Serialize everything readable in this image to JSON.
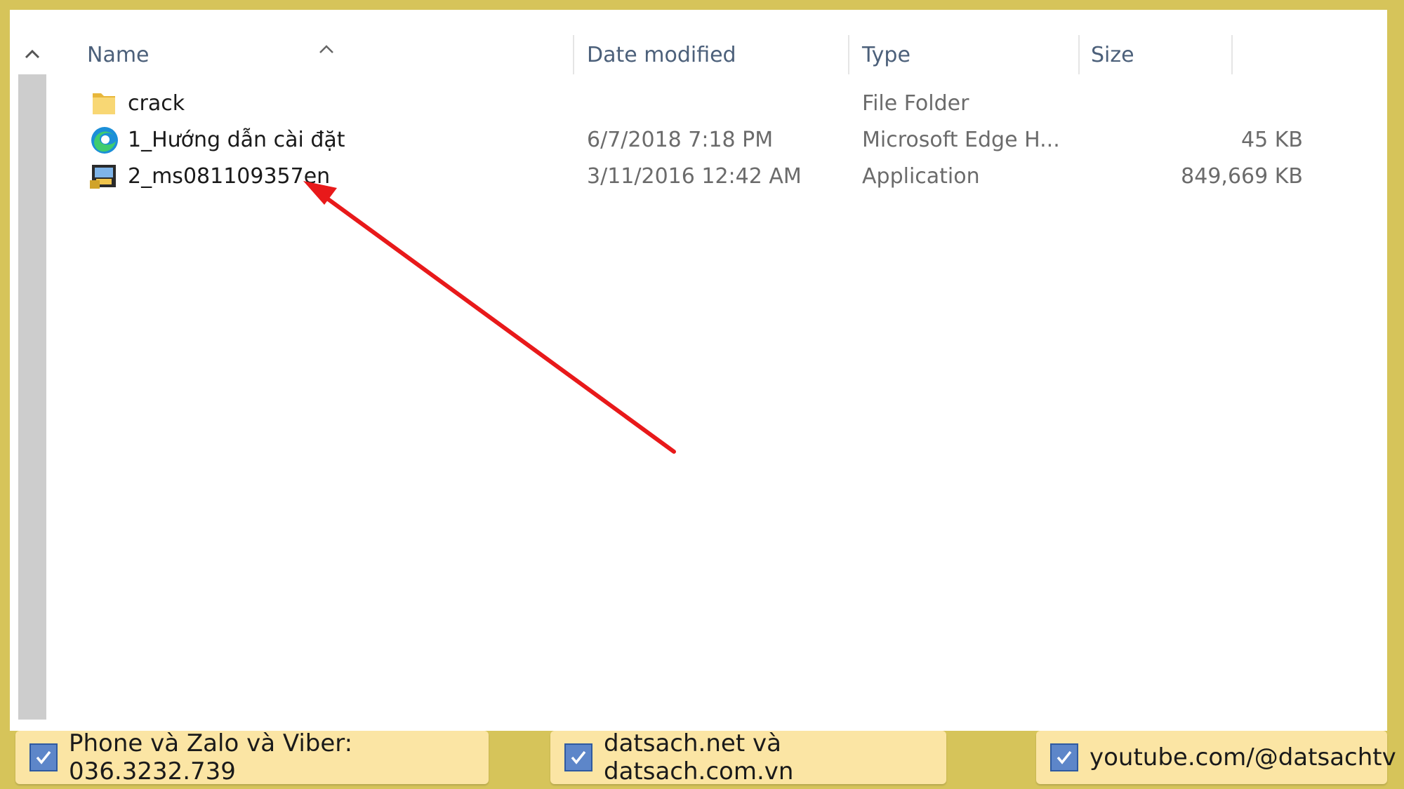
{
  "explorer": {
    "columns": {
      "name": "Name",
      "date_modified": "Date modified",
      "type": "Type",
      "size": "Size"
    },
    "files": [
      {
        "name": "crack",
        "date": "",
        "type": "File Folder",
        "size": "",
        "icon": "folder-icon"
      },
      {
        "name": "1_Hướng dẫn cài đặt",
        "date": "6/7/2018 7:18 PM",
        "type": "Microsoft Edge H...",
        "size": "45 KB",
        "icon": "edge-html-icon"
      },
      {
        "name": "2_ms081109357en",
        "date": "3/11/2016 12:42 AM",
        "type": "Application",
        "size": "849,669 KB",
        "icon": "application-icon"
      }
    ]
  },
  "footer": {
    "phone": "Phone và Zalo và Viber: 036.3232.739",
    "websites": "datsach.net và datsach.com.vn",
    "youtube": "youtube.com/@datsachtv"
  },
  "colors": {
    "background": "#d6c45a",
    "footer_box": "#fbe5a4",
    "arrow": "#e8191a",
    "header_text": "#4c607a",
    "checkbox": "#5d86c9"
  }
}
